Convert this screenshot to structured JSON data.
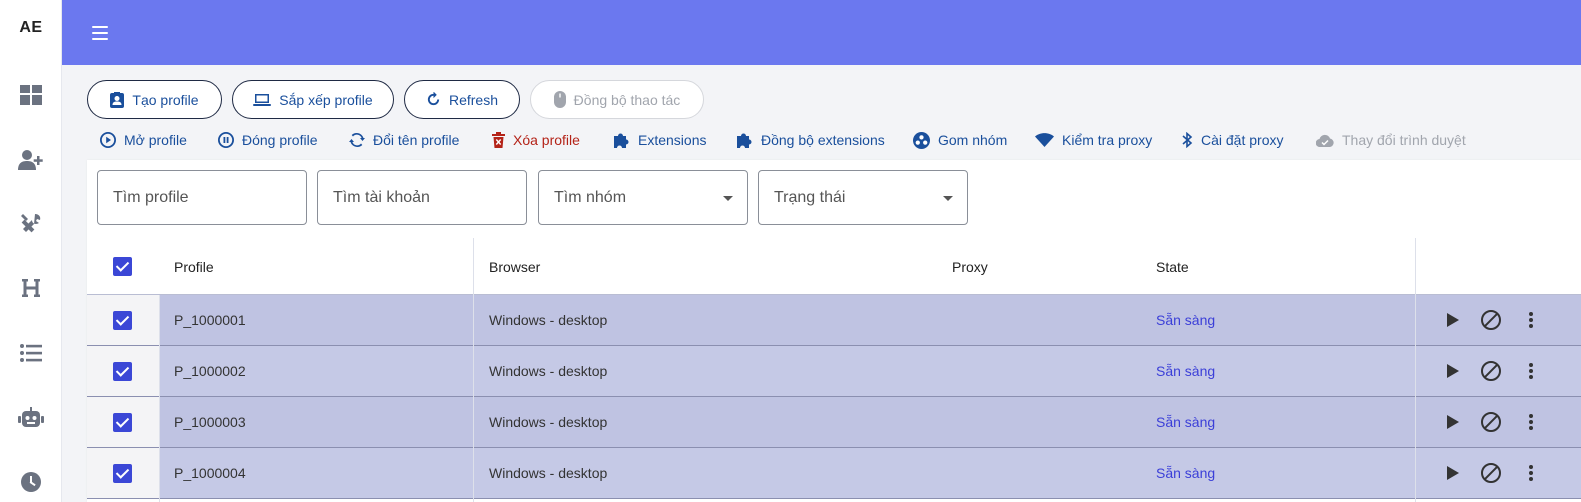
{
  "app": {
    "logo": "AE"
  },
  "rail": {
    "items": [
      {
        "icon": "dashboard-icon"
      },
      {
        "icon": "user-add-icon"
      },
      {
        "icon": "tools-icon"
      },
      {
        "icon": "heading-icon"
      },
      {
        "icon": "list-icon"
      },
      {
        "icon": "robot-icon"
      },
      {
        "icon": "clock-icon"
      }
    ]
  },
  "topbar": {
    "menu_icon": "menu-icon",
    "color": "#6b78ef"
  },
  "toolbar": {
    "create_profile": "Tạo profile",
    "arrange_profile": "Sắp xếp profile",
    "refresh": "Refresh",
    "sync_actions": "Đồng bộ thao tác"
  },
  "actions": {
    "open_profile": "Mở profile",
    "close_profile": "Đóng profile",
    "rename_profile": "Đổi tên profile",
    "delete_profile": "Xóa profile",
    "extensions": "Extensions",
    "sync_extensions": "Đồng bộ extensions",
    "group": "Gom nhóm",
    "check_proxy": "Kiểm tra proxy",
    "set_proxy": "Cài đặt proxy",
    "change_browser": "Thay đổi trình duyệt"
  },
  "filters": {
    "search_profile": "Tìm profile",
    "search_account": "Tìm tài khoản",
    "search_group": "Tìm nhóm",
    "status": "Trạng thái"
  },
  "table": {
    "headers": {
      "profile": "Profile",
      "browser": "Browser",
      "proxy": "Proxy",
      "state": "State"
    },
    "rows": [
      {
        "profile": "P_1000001",
        "browser": "Windows - desktop",
        "proxy": "",
        "state": "Sẵn sàng",
        "checked": true
      },
      {
        "profile": "P_1000002",
        "browser": "Windows - desktop",
        "proxy": "",
        "state": "Sẵn sàng",
        "checked": true
      },
      {
        "profile": "P_1000003",
        "browser": "Windows - desktop",
        "proxy": "",
        "state": "Sẵn sàng",
        "checked": true
      },
      {
        "profile": "P_1000004",
        "browser": "Windows - desktop",
        "proxy": "",
        "state": "Sẵn sàng",
        "checked": true
      }
    ]
  },
  "colors": {
    "accent": "#6b78ef",
    "link": "#1a4f9c",
    "danger": "#b42318",
    "row_band": "#bfc3e2",
    "state": "#3b3fd8",
    "checkbox": "#3b47d6"
  }
}
